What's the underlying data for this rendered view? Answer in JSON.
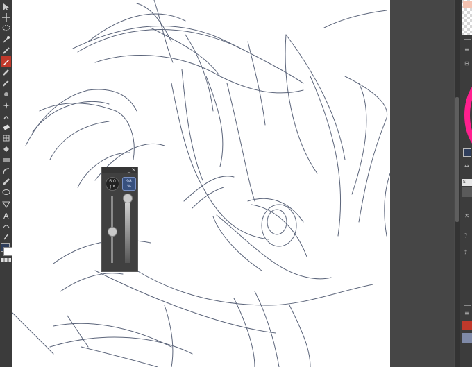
{
  "toolbar": {
    "tools": [
      {
        "icon": "select-arrow-icon",
        "active": false
      },
      {
        "icon": "move-icon",
        "active": false
      },
      {
        "icon": "lasso-icon",
        "active": false
      },
      {
        "icon": "magic-wand-icon",
        "active": false
      },
      {
        "icon": "eyedropper-icon",
        "active": false
      },
      {
        "icon": "pen-icon",
        "active": true
      },
      {
        "icon": "pencil-icon",
        "active": false
      },
      {
        "icon": "brush-icon",
        "active": false
      },
      {
        "icon": "airbrush-icon",
        "active": false
      },
      {
        "icon": "decoration-icon",
        "active": false
      },
      {
        "icon": "blend-icon",
        "active": false
      },
      {
        "icon": "eraser-icon",
        "active": false
      },
      {
        "icon": "frame-icon",
        "active": false
      },
      {
        "icon": "fill-icon",
        "active": false
      },
      {
        "icon": "gradient-icon",
        "active": false
      },
      {
        "icon": "curve-icon",
        "active": false
      },
      {
        "icon": "ruler-icon",
        "active": false
      },
      {
        "icon": "balloon-icon",
        "active": false
      },
      {
        "icon": "line-tool-icon",
        "active": false
      },
      {
        "icon": "text-icon",
        "active": false
      },
      {
        "icon": "correct-line-icon",
        "active": false
      },
      {
        "icon": "operation-icon",
        "active": false
      }
    ],
    "text_tool_glyph": "A",
    "main_color": "#2f3e5c",
    "sub_color": "#ffffff"
  },
  "brush_popup": {
    "size_value": "6.0",
    "size_unit": "px",
    "opacity_value": "98",
    "opacity_unit": "%",
    "size_level_fraction": 0.48,
    "opacity_level_fraction": 0.98,
    "close_glyph": "×",
    "minimize_glyph": "_"
  },
  "right_panel": {
    "layer_label": "S",
    "sketch_color": "#2f3e5c",
    "wheel_colors": [
      "#ff1f8e",
      "#ff2d4a",
      "#c21df0"
    ]
  },
  "canvas": {
    "background": "#ffffff",
    "stroke_color": "#3f4a63"
  }
}
